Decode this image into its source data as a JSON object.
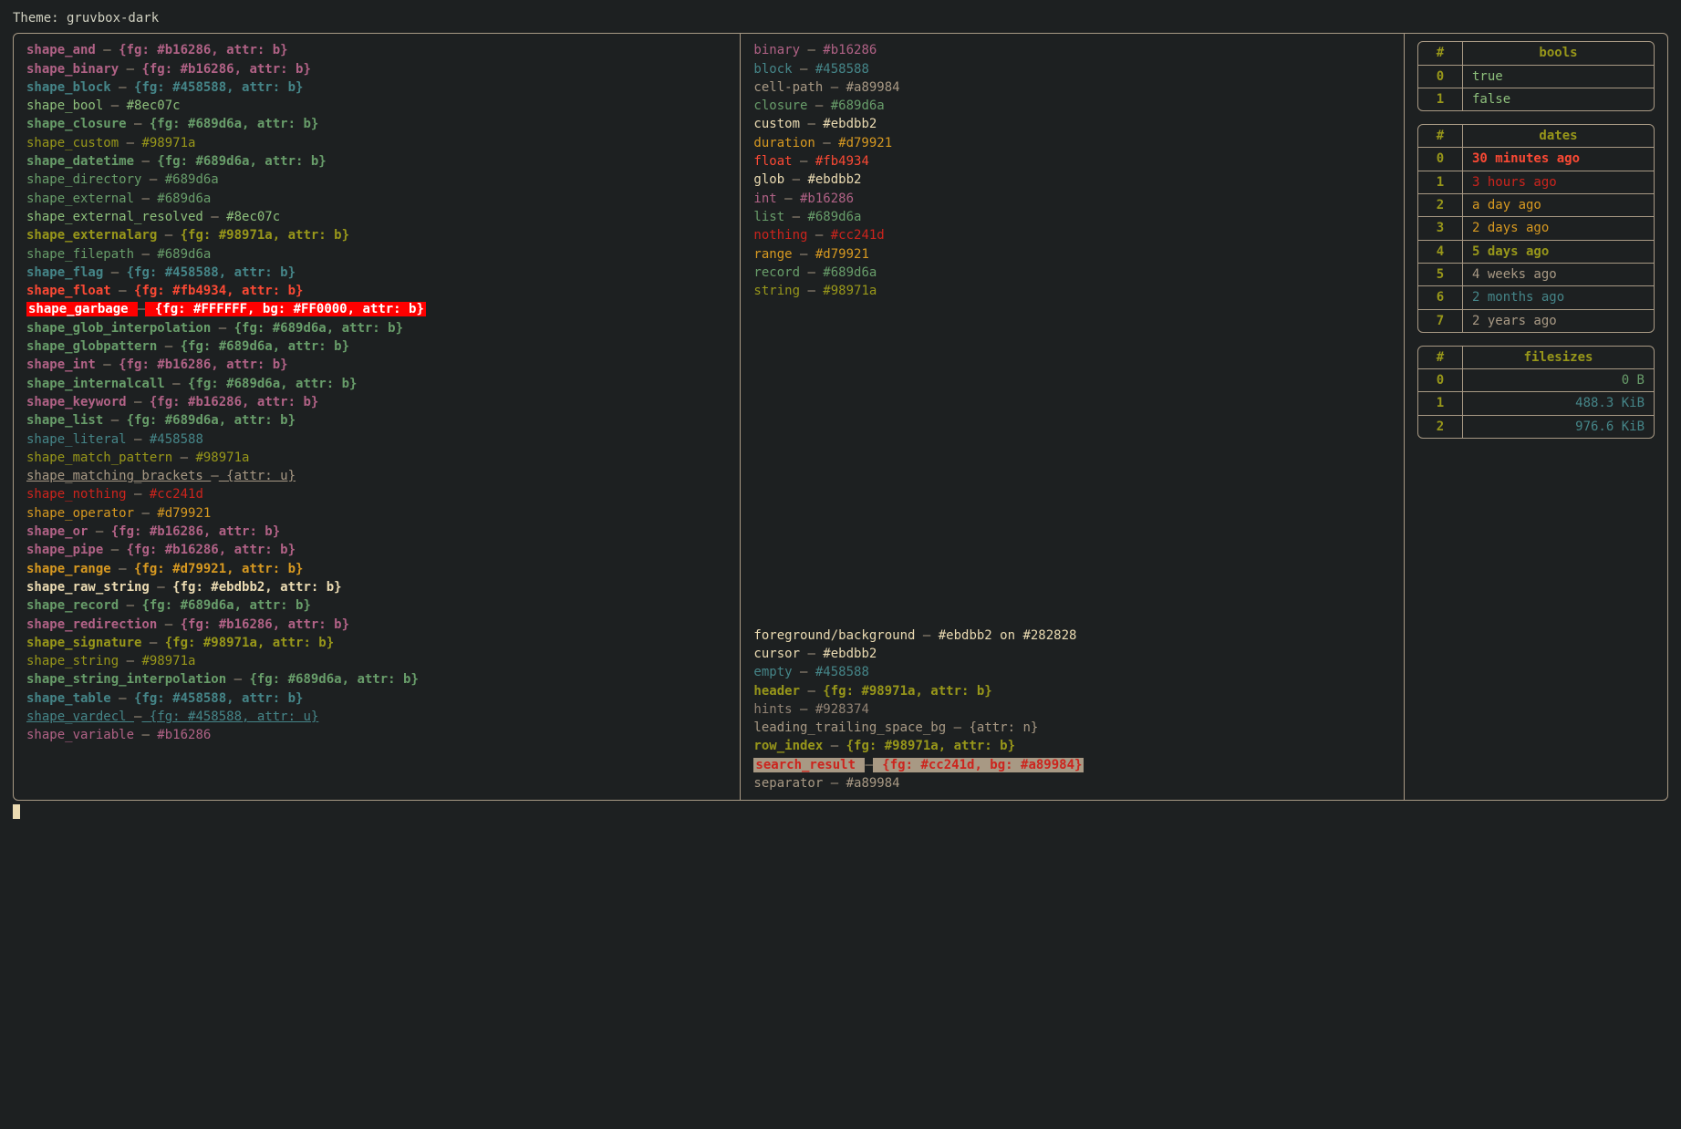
{
  "title": "Theme: gruvbox-dark",
  "palette": {
    "pink": "#b16286",
    "teal": "#458588",
    "green": "#8ec07c",
    "aqua": "#689d6a",
    "olive": "#98971a",
    "fg": "#ebdbb2",
    "orange": "#d79921",
    "red": "#fb4934",
    "darkred": "#cc241d",
    "gray": "#a89984",
    "gray2": "#928374",
    "bg": "#282828",
    "white": "#FFFFFF",
    "errorbg": "#FF0000"
  },
  "shapes": [
    {
      "name": "shape_and",
      "val": "{fg: #b16286, attr: b}",
      "cls": "c-pink b"
    },
    {
      "name": "shape_binary",
      "val": "{fg: #b16286, attr: b}",
      "cls": "c-pink b"
    },
    {
      "name": "shape_block",
      "val": "{fg: #458588, attr: b}",
      "cls": "c-teal b"
    },
    {
      "name": "shape_bool",
      "val": "#8ec07c",
      "cls": "c-green"
    },
    {
      "name": "shape_closure",
      "val": "{fg: #689d6a, attr: b}",
      "cls": "c-aqua b"
    },
    {
      "name": "shape_custom",
      "val": "#98971a",
      "cls": "c-olive"
    },
    {
      "name": "shape_datetime",
      "val": "{fg: #689d6a, attr: b}",
      "cls": "c-aqua b"
    },
    {
      "name": "shape_directory",
      "val": "#689d6a",
      "cls": "c-aqua"
    },
    {
      "name": "shape_external",
      "val": "#689d6a",
      "cls": "c-aqua"
    },
    {
      "name": "shape_external_resolved",
      "val": "#8ec07c",
      "cls": "c-green"
    },
    {
      "name": "shape_externalarg",
      "val": "{fg: #98971a, attr: b}",
      "cls": "c-olive b"
    },
    {
      "name": "shape_filepath",
      "val": "#689d6a",
      "cls": "c-aqua"
    },
    {
      "name": "shape_flag",
      "val": "{fg: #458588, attr: b}",
      "cls": "c-teal b"
    },
    {
      "name": "shape_float",
      "val": "{fg: #fb4934, attr: b}",
      "cls": "c-red b"
    },
    {
      "name": "shape_garbage",
      "val": "{fg: #FFFFFF, bg: #FF0000, attr: b}",
      "cls": "hlred"
    },
    {
      "name": "shape_glob_interpolation",
      "val": "{fg: #689d6a, attr: b}",
      "cls": "c-aqua b"
    },
    {
      "name": "shape_globpattern",
      "val": "{fg: #689d6a, attr: b}",
      "cls": "c-aqua b"
    },
    {
      "name": "shape_int",
      "val": "{fg: #b16286, attr: b}",
      "cls": "c-pink b"
    },
    {
      "name": "shape_internalcall",
      "val": "{fg: #689d6a, attr: b}",
      "cls": "c-aqua b"
    },
    {
      "name": "shape_keyword",
      "val": "{fg: #b16286, attr: b}",
      "cls": "c-pink b"
    },
    {
      "name": "shape_list",
      "val": "{fg: #689d6a, attr: b}",
      "cls": "c-aqua b"
    },
    {
      "name": "shape_literal",
      "val": "#458588",
      "cls": "c-teal"
    },
    {
      "name": "shape_match_pattern",
      "val": "#98971a",
      "cls": "c-olive"
    },
    {
      "name": "shape_matching_brackets",
      "val": "{attr: u}",
      "cls": "c-gray u"
    },
    {
      "name": "shape_nothing",
      "val": "#cc241d",
      "cls": "c-darkred"
    },
    {
      "name": "shape_operator",
      "val": "#d79921",
      "cls": "c-orange"
    },
    {
      "name": "shape_or",
      "val": "{fg: #b16286, attr: b}",
      "cls": "c-pink b"
    },
    {
      "name": "shape_pipe",
      "val": "{fg: #b16286, attr: b}",
      "cls": "c-pink b"
    },
    {
      "name": "shape_range",
      "val": "{fg: #d79921, attr: b}",
      "cls": "c-orange b"
    },
    {
      "name": "shape_raw_string",
      "val": "{fg: #ebdbb2, attr: b}",
      "cls": "c-fg b"
    },
    {
      "name": "shape_record",
      "val": "{fg: #689d6a, attr: b}",
      "cls": "c-aqua b"
    },
    {
      "name": "shape_redirection",
      "val": "{fg: #b16286, attr: b}",
      "cls": "c-pink b"
    },
    {
      "name": "shape_signature",
      "val": "{fg: #98971a, attr: b}",
      "cls": "c-olive b"
    },
    {
      "name": "shape_string",
      "val": "#98971a",
      "cls": "c-olive"
    },
    {
      "name": "shape_string_interpolation",
      "val": "{fg: #689d6a, attr: b}",
      "cls": "c-aqua b"
    },
    {
      "name": "shape_table",
      "val": "{fg: #458588, attr: b}",
      "cls": "c-teal b"
    },
    {
      "name": "shape_vardecl",
      "val": "{fg: #458588, attr: u}",
      "cls": "c-teal u"
    },
    {
      "name": "shape_variable",
      "val": "#b16286",
      "cls": "c-pink"
    }
  ],
  "types": [
    {
      "name": "binary",
      "val": "#b16286",
      "cls": "c-pink"
    },
    {
      "name": "block",
      "val": "#458588",
      "cls": "c-teal"
    },
    {
      "name": "cell-path",
      "val": "#a89984",
      "cls": "c-gray"
    },
    {
      "name": "closure",
      "val": "#689d6a",
      "cls": "c-aqua"
    },
    {
      "name": "custom",
      "val": "#ebdbb2",
      "cls": "c-fg"
    },
    {
      "name": "duration",
      "val": "#d79921",
      "cls": "c-orange"
    },
    {
      "name": "float",
      "val": "#fb4934",
      "cls": "c-red"
    },
    {
      "name": "glob",
      "val": "#ebdbb2",
      "cls": "c-fg"
    },
    {
      "name": "int",
      "val": "#b16286",
      "cls": "c-pink"
    },
    {
      "name": "list",
      "val": "#689d6a",
      "cls": "c-aqua"
    },
    {
      "name": "nothing",
      "val": "#cc241d",
      "cls": "c-darkred"
    },
    {
      "name": "range",
      "val": "#d79921",
      "cls": "c-orange"
    },
    {
      "name": "record",
      "val": "#689d6a",
      "cls": "c-aqua"
    },
    {
      "name": "string",
      "val": "#98971a",
      "cls": "c-olive"
    }
  ],
  "misc": [
    {
      "name": "foreground/background",
      "val": "#ebdbb2 on #282828",
      "cls": "c-fg"
    },
    {
      "name": "cursor",
      "val": "#ebdbb2",
      "cls": "c-fg"
    },
    {
      "name": "empty",
      "val": "#458588",
      "cls": "c-teal"
    },
    {
      "name": "header",
      "val": "{fg: #98971a, attr: b}",
      "cls": "c-olive b"
    },
    {
      "name": "hints",
      "val": "#928374",
      "cls": "c-gray2"
    },
    {
      "name": "leading_trailing_space_bg",
      "val": "{attr: n}",
      "cls": "c-gray"
    },
    {
      "name": "row_index",
      "val": "{fg: #98971a, attr: b}",
      "cls": "c-olive b"
    },
    {
      "name": "search_result",
      "val": "{fg: #cc241d, bg: #a89984}",
      "cls": "hl-sr"
    },
    {
      "name": "separator",
      "val": "#a89984",
      "cls": "c-gray"
    }
  ],
  "tables": {
    "bools": {
      "headers": [
        "#",
        "bools"
      ],
      "rows": [
        {
          "idx": "0",
          "val": "true",
          "cls": "c-green"
        },
        {
          "idx": "1",
          "val": "false",
          "cls": "c-green"
        }
      ]
    },
    "dates": {
      "headers": [
        "#",
        "dates"
      ],
      "rows": [
        {
          "idx": "0",
          "val": "30 minutes ago",
          "cls": "c-red b"
        },
        {
          "idx": "1",
          "val": "3 hours ago",
          "cls": "c-darkred"
        },
        {
          "idx": "2",
          "val": "a day ago",
          "cls": "c-orange"
        },
        {
          "idx": "3",
          "val": "2 days ago",
          "cls": "c-orange"
        },
        {
          "idx": "4",
          "val": "5 days ago",
          "cls": "c-olive b"
        },
        {
          "idx": "5",
          "val": "4 weeks ago",
          "cls": "c-gray"
        },
        {
          "idx": "6",
          "val": "2 months ago",
          "cls": "c-teal"
        },
        {
          "idx": "7",
          "val": "2 years ago",
          "cls": "c-gray"
        }
      ]
    },
    "filesizes": {
      "headers": [
        "#",
        "filesizes"
      ],
      "rows": [
        {
          "idx": "0",
          "val": "0 B",
          "cls": "c-aqua"
        },
        {
          "idx": "1",
          "val": "488.3 KiB",
          "cls": "c-teal"
        },
        {
          "idx": "2",
          "val": "976.6 KiB",
          "cls": "c-teal"
        }
      ]
    }
  }
}
